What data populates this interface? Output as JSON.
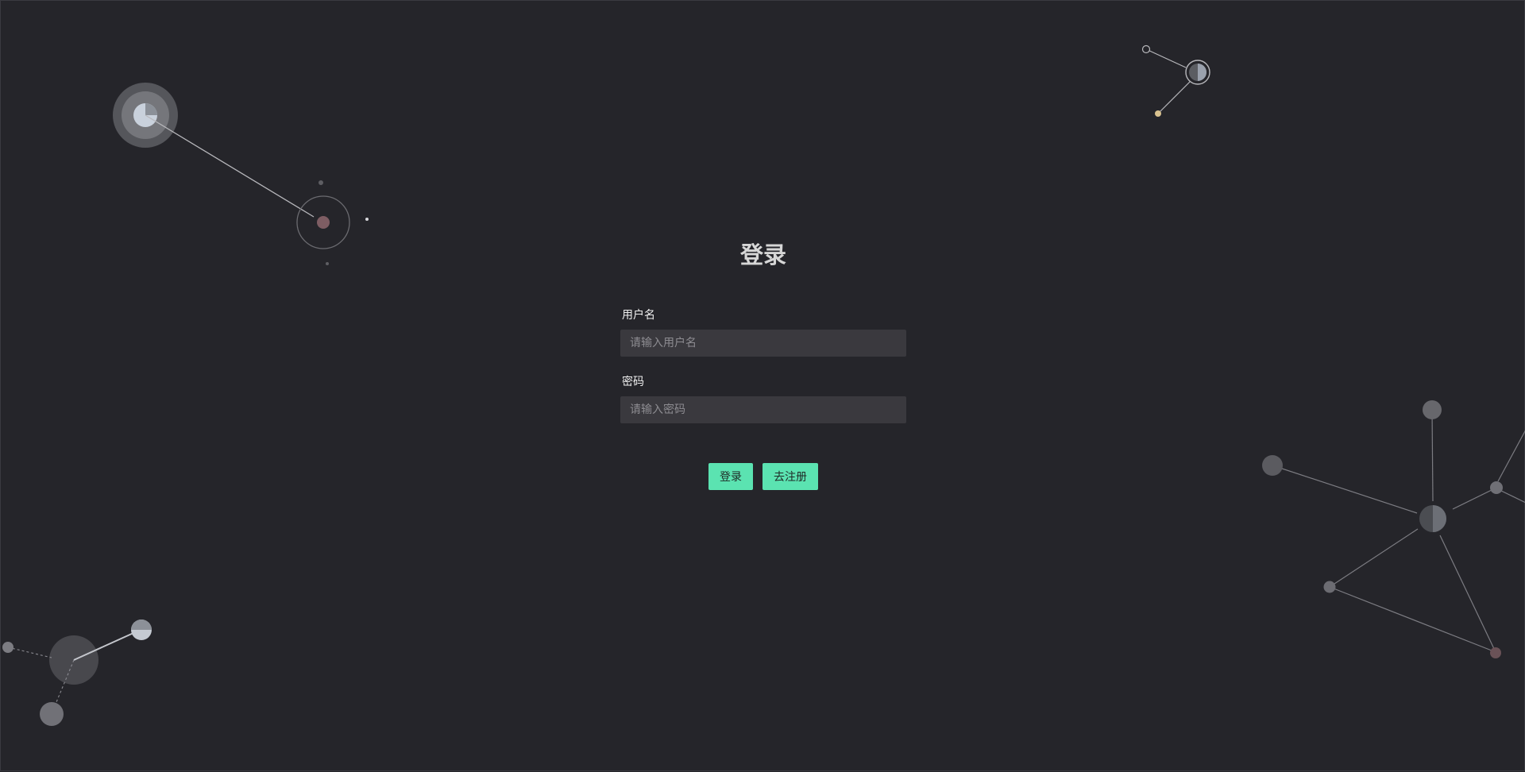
{
  "colors": {
    "background": "#25252a",
    "input_background": "#3a393e",
    "accent": "#5be3b1",
    "title": "#d6d6d6",
    "label": "#f0f0f0",
    "placeholder": "#8d8c91"
  },
  "login": {
    "title": "登录",
    "username": {
      "label": "用户名",
      "placeholder": "请输入用户名",
      "value": ""
    },
    "password": {
      "label": "密码",
      "placeholder": "请输入密码",
      "value": ""
    },
    "login_button": "登录",
    "register_button": "去注册"
  }
}
